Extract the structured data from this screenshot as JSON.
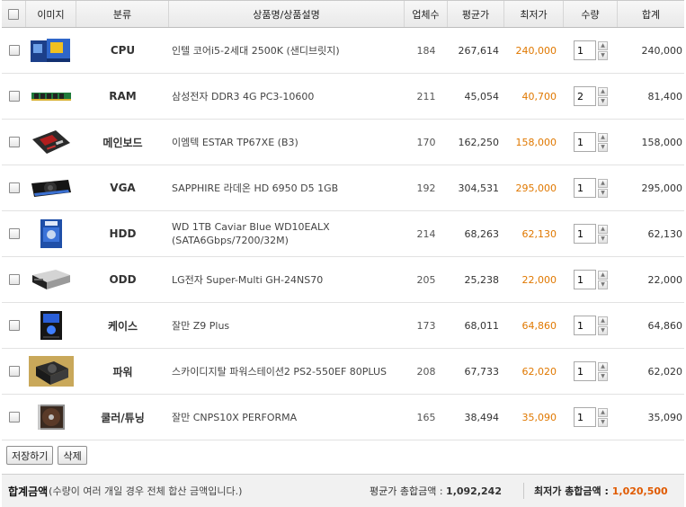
{
  "header": {
    "image": "이미지",
    "category": "분류",
    "name": "상품명/상품설명",
    "sellers": "업체수",
    "avg_price": "평균가",
    "min_price": "최저가",
    "qty": "수량",
    "total": "합계"
  },
  "rows": [
    {
      "category": "CPU",
      "name": "인텔 코어i5-2세대 2500K (샌디브릿지)",
      "sellers": "184",
      "avg": "267,614",
      "min": "240,000",
      "qty": "1",
      "total": "240,000",
      "image_icon": "cpu-box-icon"
    },
    {
      "category": "RAM",
      "name": "삼성전자 DDR3 4G PC3-10600",
      "sellers": "211",
      "avg": "45,054",
      "min": "40,700",
      "qty": "2",
      "total": "81,400",
      "image_icon": "ram-stick-icon"
    },
    {
      "category": "메인보드",
      "name": "이엠텍 ESTAR TP67XE (B3)",
      "sellers": "170",
      "avg": "162,250",
      "min": "158,000",
      "qty": "1",
      "total": "158,000",
      "image_icon": "motherboard-icon"
    },
    {
      "category": "VGA",
      "name": "SAPPHIRE 라데온 HD 6950 D5 1GB",
      "sellers": "192",
      "avg": "304,531",
      "min": "295,000",
      "qty": "1",
      "total": "295,000",
      "image_icon": "graphics-card-icon"
    },
    {
      "category": "HDD",
      "name": "WD 1TB Caviar Blue WD10EALX",
      "name2": "(SATA6Gbps/7200/32M)",
      "sellers": "214",
      "avg": "68,263",
      "min": "62,130",
      "qty": "1",
      "total": "62,130",
      "image_icon": "hard-drive-icon"
    },
    {
      "category": "ODD",
      "name": "LG전자 Super-Multi GH-24NS70",
      "sellers": "205",
      "avg": "25,238",
      "min": "22,000",
      "qty": "1",
      "total": "22,000",
      "image_icon": "optical-drive-icon"
    },
    {
      "category": "케이스",
      "name": "잘만 Z9 Plus",
      "sellers": "173",
      "avg": "68,011",
      "min": "64,860",
      "qty": "1",
      "total": "64,860",
      "image_icon": "pc-case-icon"
    },
    {
      "category": "파워",
      "name": "스카이디지탈 파워스테이션2 PS2-550EF 80PLUS",
      "sellers": "208",
      "avg": "67,733",
      "min": "62,020",
      "qty": "1",
      "total": "62,020",
      "image_icon": "power-supply-icon"
    },
    {
      "category": "쿨러/튜닝",
      "name": "잘만 CNPS10X PERFORMA",
      "sellers": "165",
      "avg": "38,494",
      "min": "35,090",
      "qty": "1",
      "total": "35,090",
      "image_icon": "cpu-cooler-icon"
    }
  ],
  "actions": {
    "save": "저장하기",
    "delete": "삭제"
  },
  "footer": {
    "label": "합계금액",
    "note": "(수량이 여러 개일 경우 전체 합산 금액입니다.)",
    "avg_label": "평균가 총합금액 : ",
    "avg_total": "1,092,242",
    "min_label": "최저가 총합금액 : ",
    "min_total": "1,020,500"
  },
  "colors": {
    "min_price": "#e07800",
    "min_total": "#e05a00",
    "header_bg": "#efefef"
  }
}
